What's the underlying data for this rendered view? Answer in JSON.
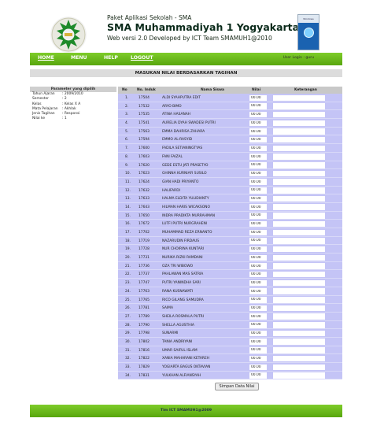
{
  "header": {
    "app_name": "Paket Aplikasi Sekolah - SMA",
    "school_name": "SMA Muhammadiyah 1 Yogyakarta",
    "version": "Web versi 2.0 Developed by ICT Team SMAMUH1@2010",
    "badge_text": "Windows"
  },
  "nav": {
    "home": "HOME",
    "menu": "MENU",
    "help": "HELP",
    "logout": "LOGOUT",
    "user_login": "User Login : guru"
  },
  "section_title": "MASUKAN NILAI BERDASARKAN TAGIHAN",
  "params": {
    "heading": "Parameter yang dipilih",
    "items": [
      {
        "key": "Tahun Ajaran",
        "value": ": 2009/2010"
      },
      {
        "key": "Semester",
        "value": ": 2"
      },
      {
        "key": "Kelas",
        "value": ": Kelas X A"
      },
      {
        "key": "Mata Pelajaran",
        "value": ": Akhlak"
      },
      {
        "key": "Jenis Tagihan",
        "value": ": Responsi"
      },
      {
        "key": "Nilai ke",
        "value": ": 1"
      }
    ]
  },
  "table": {
    "headers": {
      "no": "No",
      "nis": "No. Induk",
      "name": "Nama Siswa",
      "nilai": "Nilai",
      "keterangan": "Keterangan"
    },
    "rows": [
      {
        "no": "1.",
        "nis": "17504",
        "name": "ALDI SYAHPUTRA EDIT",
        "nilai": "00.00"
      },
      {
        "no": "2.",
        "nis": "17532",
        "name": "ARYO BIMO",
        "nilai": "00.00"
      },
      {
        "no": "3.",
        "nis": "17535",
        "name": "ATINA HASANAH",
        "nilai": "00.00"
      },
      {
        "no": "4.",
        "nis": "17541",
        "name": "AURELIA DYAH SWADESI PUTRI",
        "nilai": "00.00"
      },
      {
        "no": "5.",
        "nis": "17563",
        "name": "EMMA DAHRISA ZAHARA",
        "nilai": "00.00"
      },
      {
        "no": "6.",
        "nis": "17594",
        "name": "EMMO AL-RASYID",
        "nilai": "00.00"
      },
      {
        "no": "7.",
        "nis": "17600",
        "name": "FADILA SETIANINGTYAS",
        "nilai": "00.00"
      },
      {
        "no": "8.",
        "nis": "17603",
        "name": "FANI FAIZAL",
        "nilai": "00.00"
      },
      {
        "no": "9.",
        "nis": "17620",
        "name": "GEDE ESTU JATI PRASETYO",
        "nilai": "00.00"
      },
      {
        "no": "10.",
        "nis": "17623",
        "name": "GHINNA KURNIAFI SUSILO",
        "nilai": "00.00"
      },
      {
        "no": "11.",
        "nis": "17624",
        "name": "GIAN HADI PRIYANTO",
        "nilai": "00.00"
      },
      {
        "no": "12.",
        "nis": "17632",
        "name": "HALIFARDI",
        "nilai": "00.00"
      },
      {
        "no": "13.",
        "nis": "17633",
        "name": "HALMA ELDITA YULIDIANTY",
        "nilai": "00.00"
      },
      {
        "no": "14.",
        "nis": "17643",
        "name": "HILMAN HARIS WICAKSONO",
        "nilai": "00.00"
      },
      {
        "no": "15.",
        "nis": "17650",
        "name": "INDRA PRADIKTA MURRAHMAN",
        "nilai": "00.00"
      },
      {
        "no": "16.",
        "nis": "17672",
        "name": "LUTFI PUTRI NURGRAHENI",
        "nilai": "00.00"
      },
      {
        "no": "17.",
        "nis": "17702",
        "name": "MUHAMMAD REZA ERNANTO",
        "nilai": "00.00"
      },
      {
        "no": "18.",
        "nis": "17719",
        "name": "NAZARUDIN FIRDAUS",
        "nilai": "00.00"
      },
      {
        "no": "19.",
        "nis": "17728",
        "name": "NUR CHOIRINA KUNTARI",
        "nilai": "00.00"
      },
      {
        "no": "20.",
        "nis": "17731",
        "name": "NURIKA RIZKI RAMDANI",
        "nilai": "00.00"
      },
      {
        "no": "21.",
        "nis": "17736",
        "name": "OZA TRI WIBOWO",
        "nilai": "00.00"
      },
      {
        "no": "22.",
        "nis": "17737",
        "name": "PAHLAWAN MAS SATRIA",
        "nilai": "00.00"
      },
      {
        "no": "23.",
        "nis": "17747",
        "name": "PUTRI YANINDHA SARI",
        "nilai": "00.00"
      },
      {
        "no": "24.",
        "nis": "17763",
        "name": "RANA KUSNAWATI",
        "nilai": "00.00"
      },
      {
        "no": "25.",
        "nis": "17765",
        "name": "RICO GILANG SAMUDRA",
        "nilai": "00.00"
      },
      {
        "no": "26.",
        "nis": "17781",
        "name": "SAIMA",
        "nilai": "00.00"
      },
      {
        "no": "27.",
        "nis": "17789",
        "name": "SHEILA ROSMALA PUTRI",
        "nilai": "00.00"
      },
      {
        "no": "28.",
        "nis": "17790",
        "name": "SHELLA AGUSTHIA",
        "nilai": "00.00"
      },
      {
        "no": "29.",
        "nis": "17798",
        "name": "SUNARMI",
        "nilai": "00.00"
      },
      {
        "no": "30.",
        "nis": "17802",
        "name": "TANIA ANDRIYANI",
        "nilai": "00.00"
      },
      {
        "no": "31.",
        "nis": "17816",
        "name": "UMAR SAIFUL ISLAM",
        "nilai": "00.00"
      },
      {
        "no": "32.",
        "nis": "17822",
        "name": "XANIA MAHARANI KETAREH",
        "nilai": "00.00"
      },
      {
        "no": "33.",
        "nis": "17829",
        "name": "YOGIARTA BAGUS OKTAVIAN",
        "nilai": "00.00"
      },
      {
        "no": "34.",
        "nis": "17831",
        "name": "YULKHAN ALFIANSYAH",
        "nilai": "00.00"
      }
    ],
    "save_button": "Simpan Data Nilai"
  },
  "footer": "Tim ICT SMAMUH1@2009",
  "colors": {
    "nav_green": "#6ab81c",
    "row_lavender": "#c4c4f6",
    "header_gray": "#c8c8c8"
  }
}
